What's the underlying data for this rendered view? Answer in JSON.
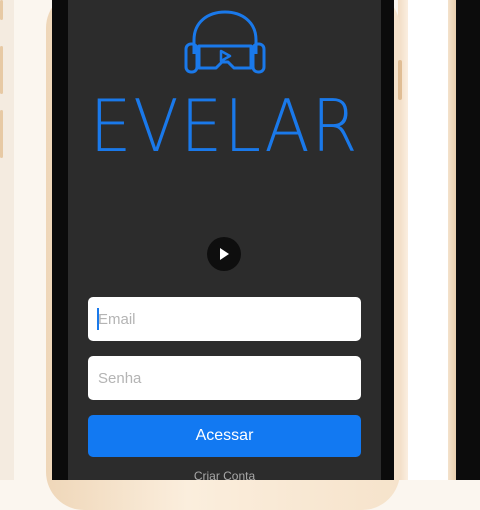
{
  "app": {
    "logo_text": "EVELAR",
    "logo_icon": "vr-headset-play-icon",
    "accent_color": "#1a79ea"
  },
  "media": {
    "play_icon": "play-icon"
  },
  "login": {
    "email_placeholder": "Email",
    "password_placeholder": "Senha",
    "submit_label": "Acessar",
    "submit_color": "#1279f2",
    "create_account_label": "Criar Conta"
  }
}
